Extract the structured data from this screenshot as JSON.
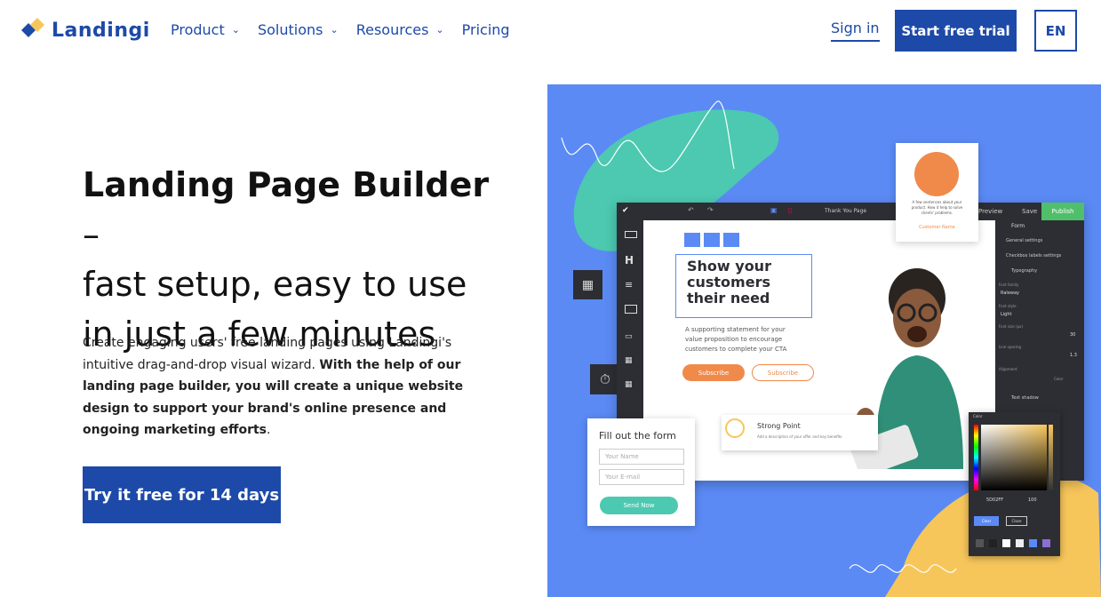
{
  "header": {
    "logo_text": "Landingi",
    "nav": [
      {
        "label": "Product",
        "has_dropdown": true
      },
      {
        "label": "Solutions",
        "has_dropdown": true
      },
      {
        "label": "Resources",
        "has_dropdown": true
      },
      {
        "label": "Pricing",
        "has_dropdown": false
      }
    ],
    "sign_in": "Sign in",
    "start_trial": "Start free trial",
    "language": "EN"
  },
  "hero": {
    "title_bold": "Landing Page Builder",
    "title_rest_1": " –",
    "title_line2": "fast setup, easy to use",
    "title_line3": "in just a few minutes",
    "desc_plain_1": "Create engaging users' free landing pages using Landingi's intuitive drag-and-drop visual wizard. ",
    "desc_bold": "With the help of our landing page builder, you will create a unique website design to support your brand's online presence and ongoing marketing efforts",
    "desc_plain_2": ".",
    "cta": "Try it free for 14 days"
  },
  "illustration": {
    "editor_page_name": "Thank You Page",
    "preview": "Preview",
    "save": "Save",
    "publish": "Publish",
    "canvas_heading": "Show your customers their need",
    "canvas_sub": "A supporting statement for your value proposition to encourage customers to complete your CTA",
    "subscribe_primary": "Subscribe",
    "subscribe_secondary": "Subscribe",
    "strong_point_title": "Strong Point",
    "strong_point_desc": "Add a description of your offer and key benefits",
    "testimonial_text": "A few sentences about your product. How it help to solve clients' problems.",
    "testimonial_name": "Customer Name",
    "form_title": "Fill out the form",
    "form_name_placeholder": "Your Name",
    "form_email_placeholder": "Your E-mail",
    "form_button": "Send Now",
    "panel_title": "Form",
    "panel_general": "General settings",
    "panel_checkbox": "Checkbox labels settings",
    "panel_typography": "Typography",
    "panel_font_family_label": "Font family",
    "panel_font_family": "Raleway",
    "panel_font_style_label": "Font style",
    "panel_font_style": "Light",
    "panel_font_size_label": "Font size (px)",
    "panel_font_size": "30",
    "panel_line_spacing_label": "Line spacing",
    "panel_line_spacing": "1.3",
    "panel_alignment": "Alignment",
    "panel_color": "Color",
    "panel_text_shadow": "Text shadow",
    "color_panel_title": "Color",
    "color_hex": "5D02FF",
    "color_opacity": "100",
    "color_clear": "Clear",
    "color_close": "Close"
  },
  "colors": {
    "brand": "#1d4aa8",
    "illustration_bg": "#5b8af5",
    "teal": "#4cc9b0",
    "yellow": "#f7c65b",
    "orange": "#f08a4b",
    "publish_green": "#4fbf6a"
  }
}
